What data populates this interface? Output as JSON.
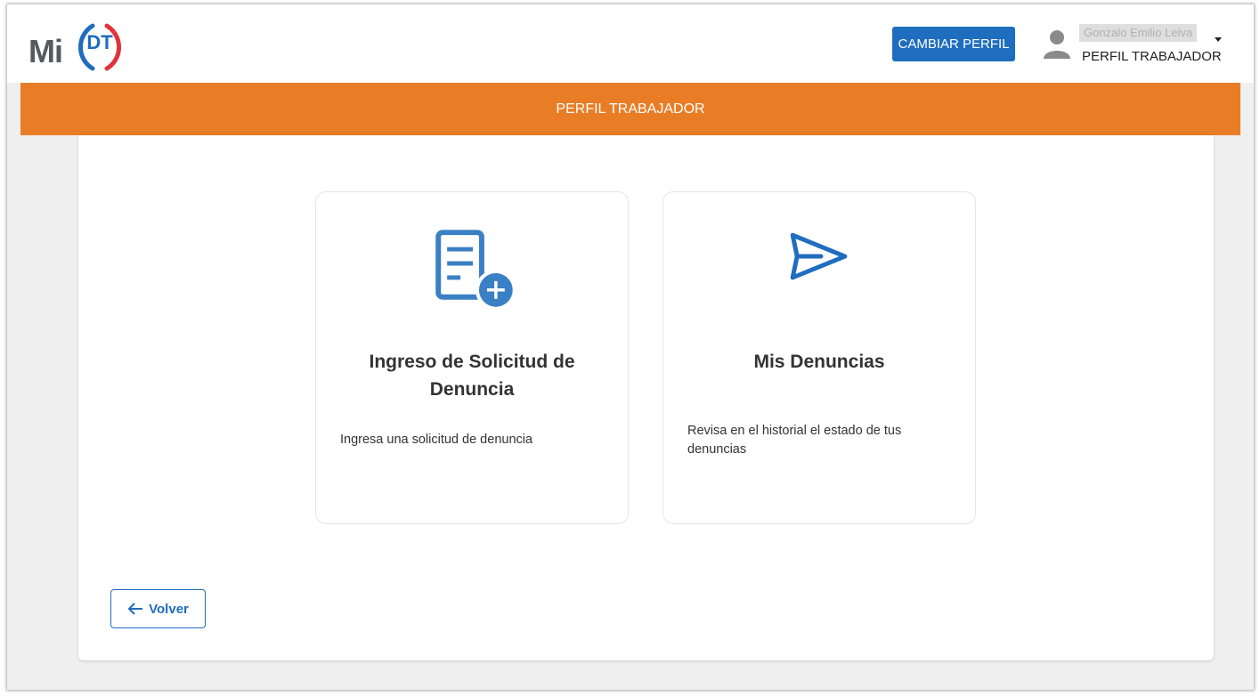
{
  "header": {
    "logo_mi": "Mi",
    "logo_dt": "DT",
    "cambiar_perfil_label": "CAMBIAR PERFIL",
    "user_name": "Gonzalo Emilio Leiva",
    "user_role": "PERFIL TRABAJADOR",
    "user_icon": "person-icon",
    "caret_icon": "caret-down-icon"
  },
  "banner": {
    "title": "PERFIL TRABAJADOR"
  },
  "cards": [
    {
      "icon": "document-add-icon",
      "title": "Ingreso de Solicitud de Denuncia",
      "description": "Ingresa una solicitud de denuncia"
    },
    {
      "icon": "send-icon",
      "title": "Mis Denuncias",
      "description": "Revisa en el historial el estado de tus denuncias"
    }
  ],
  "footer": {
    "back_label": "Volver",
    "back_icon": "arrow-left-icon"
  },
  "colors": {
    "primary_blue": "#1f6dbf",
    "icon_blue": "#3a80c4",
    "banner_orange": "#e87d26",
    "logo_blue": "#1f6dbf",
    "logo_red": "#e0343a",
    "page_bg": "#efefef"
  }
}
